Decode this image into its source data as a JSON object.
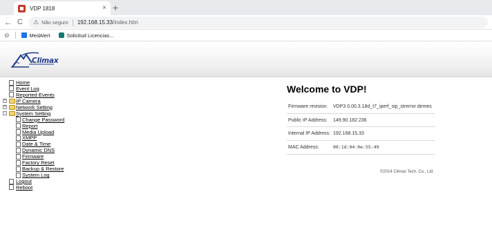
{
  "browser": {
    "tab_title": "VDP 1818",
    "tab_close": "×",
    "new_tab": "+",
    "back": "←",
    "reload": "C",
    "security_warning": "Não seguro",
    "url_host": "192.168.15.33",
    "url_path": "/index.htm",
    "bookmarks": [
      {
        "label": "MedAlert"
      },
      {
        "label": "Solicitud Licencias..."
      }
    ]
  },
  "header": {
    "logo_text": "Climax"
  },
  "nav_tree": {
    "items": [
      {
        "label": "Home",
        "type": "page",
        "level": 0
      },
      {
        "label": "Event Log",
        "type": "page",
        "level": 0
      },
      {
        "label": "Reported Events",
        "type": "page",
        "level": 0
      },
      {
        "label": "IP Camera",
        "type": "folder",
        "level": 0,
        "expander": "+"
      },
      {
        "label": "Network Setting",
        "type": "folder",
        "level": 0,
        "expander": "+"
      },
      {
        "label": "System Setting",
        "type": "folder",
        "level": 0,
        "expander": "-"
      },
      {
        "label": "Change Password",
        "type": "page",
        "level": 1
      },
      {
        "label": "Report",
        "type": "page",
        "level": 1
      },
      {
        "label": "Media Upload",
        "type": "page",
        "level": 1
      },
      {
        "label": "XMPP",
        "type": "page",
        "level": 1
      },
      {
        "label": "Date & Time",
        "type": "page",
        "level": 1
      },
      {
        "label": "Dynamic DNS",
        "type": "page",
        "level": 1
      },
      {
        "label": "Firmware",
        "type": "page",
        "level": 1
      },
      {
        "label": "Factory Reset",
        "type": "page",
        "level": 1
      },
      {
        "label": "Backup & Restore",
        "type": "page",
        "level": 1
      },
      {
        "label": "System Log",
        "type": "page",
        "level": 1
      },
      {
        "label": "Logout",
        "type": "page",
        "level": 0
      },
      {
        "label": "Reboot",
        "type": "page",
        "level": 0
      }
    ]
  },
  "main": {
    "welcome_title": "Welcome to VDP!",
    "info": [
      {
        "key": "Firmware revision:",
        "value": "VDP3 0.00.3.18d_t7_iperf_sip_strerror demes"
      },
      {
        "key": "Public IP Address:",
        "value": "149.90.182.236"
      },
      {
        "key": "Internal IP Address:",
        "value": "192.168.15.33"
      },
      {
        "key": "MAC Address:",
        "value": "00:1d:94:0e:55:49"
      }
    ],
    "copyright": "©2014 Climax Tech. Co., Ltd."
  },
  "colors": {
    "logo_blue": "#1f3c8a",
    "folder_yellow": "#f5d36a"
  }
}
